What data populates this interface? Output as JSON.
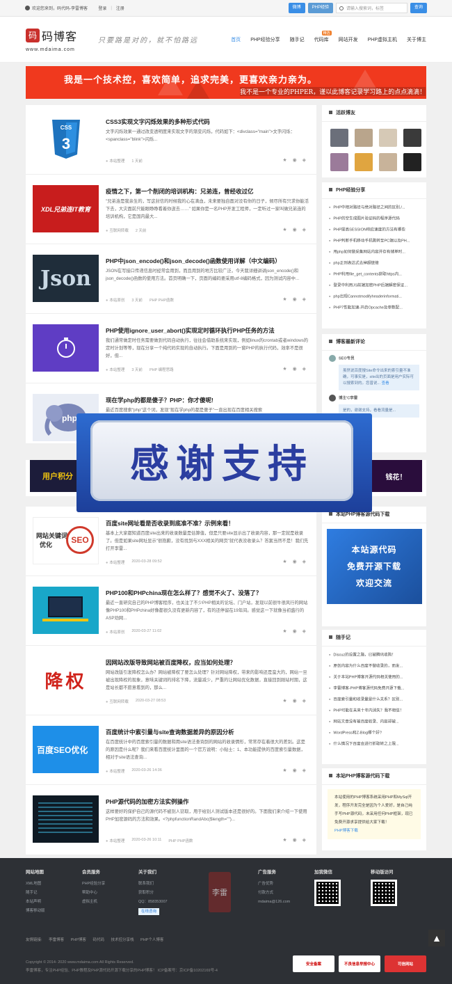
{
  "topbar": {
    "welcome": "欢迎您来到，码代码-李雷博客",
    "login": "登录",
    "register": "注册",
    "btn_sina": "微博",
    "btn_php": "PHP经验",
    "search_placeholder": "请输入搜索词，标签",
    "search_btn": "查询"
  },
  "header": {
    "logo_seal": "码",
    "logo_name": "码博客",
    "logo_url": "www.mdaima.com",
    "slogan": "只要路是对的，就不怕路远",
    "nav": [
      "首页",
      "PHP经验分享",
      "随手记",
      "代码库",
      "网站开发",
      "PHP虚拟主机",
      "关于博主"
    ],
    "nav_hot_badge": "精选"
  },
  "banner": {
    "line1": "我是一个技术控，喜欢简单，追求完美，更喜欢亲力亲为。",
    "line2": "我不是一个专业的PHPER，谨以此博客记录学习路上的点点滴滴！"
  },
  "posts": [
    {
      "title": "CSS3实现文字闪烁效果的多种形式代码",
      "desc": "文字闪烁效果一通过改变透明度来实现文字的渐变闪烁，代码如下：<divclass=\"main\">文字闪烁：<spanclass=\"blink\">闪烁...",
      "author": "本站整理",
      "date": "1 天前",
      "tags": "",
      "thumb": "css3"
    },
    {
      "title": "疫情之下，第一个削闭的培训机构：兄弟连，曾经收过亿",
      "desc": "\"兄弟连是我亲生的，写这封信的时候我的心在滴血，未来要独自面对没有你的日子，倾尽所有只求你能活下去，大灾面前只能眼睁睁看着你逝去……\" 如果你是一名PHP开发工程师，一定听过一家叫做兄弟连的培训机构，它是国内最大...",
      "author": "互联网转载",
      "date": "2 天前",
      "tags": "",
      "thumb": "xdl"
    },
    {
      "title": "PHP中json_encode()和json_decode()函数使用详解（中文编码）",
      "desc": "JSON在写接口传递信息时经常会用到，而且用到的地方比较广泛，今天我详细讲讲json_encode()和json_decode()函数的使用方法。首页明确一下，页面的编码要采用utf-8编码格式，因为测试内容中...",
      "author": "本站原创",
      "date": "3 天前",
      "tags": "PHP  PHP函数",
      "thumb": "json"
    },
    {
      "title": "PHP使用ignore_user_abort()实现定时循环执行PHP任务的方法",
      "desc": "我们通常做定时任务需要做到代码自动执行，往往会借助系统来实现，例如linux的crontab或者windows的定时计划等等，现在分享一个纯代码实现的自动执行。下面是用到的一窗PHP的执行代码，效率不是很好，但...",
      "author": "本站整理",
      "date": "3 天前",
      "tags": "PHP  编程思路",
      "thumb": "timer"
    },
    {
      "title": "现在学php的都是傻子？PHP：你才傻呢!",
      "desc": "最近百度搜索\"php\"这个词，发现\"现在学php的都是傻子\"一直出现在百度相关搜索",
      "author": "",
      "date": "",
      "tags": "",
      "thumb": "elephant"
    }
  ],
  "ad_strip": {
    "left": "用户积分",
    "right": "钱花！"
  },
  "overlay_text": "感谢支持",
  "posts2": [
    {
      "title": "百度site网址看是否收录到底准不准？示例来看！",
      "desc": "基本上大家都知道百度site出来的收录数量是估算值，但是只要site显示出了收录内容，那一定就是收录了。但是如果site网址显示\"很抱歉，没有找到与XXX相关的网页\"就代表没收录么？答案当然不是！我们先打开李雷...",
      "author": "本站整理",
      "date": "2020-03-28 09:52",
      "tags": "",
      "thumb": "seo"
    },
    {
      "title": "PHP100和PHPchina现在怎么样了？感觉不火了、没落了？",
      "desc": "最近一直研究自己的PHP博客程序，也关注了不少PHP相关的论坛、门户站，发现以前很牛很风行的网站像PHP100和PHPchina好像都很久没有更新内容了，有的还停留在19年间。感觉这一下就像当初盛行的ASP劝网...",
      "author": "本站原创",
      "date": "2020-03-27 11:02",
      "tags": "",
      "thumb": "desk"
    },
    {
      "title": "因网站改版导致网站被百度降权，应当如何处理？",
      "desc": "网站改版引发降权怎么办？网站被降权了要怎么处理？针对网站降权，带来的影响还是蛮大的，网站一旦被出现降权的现象，意味关键词的排名下降，流量减少，严重的让网站优化数据，直接回到刚站时期，这是站长都不愿意看到的，那么...",
      "author": "互联网转载",
      "date": "2020-03-27 08:53",
      "tags": "",
      "thumb": "jiangquan"
    },
    {
      "title": "百度统计中索引量与site查询数据差异的原因分析",
      "desc": "在百度统计中的百度索引量的数据和用site语法查询到的网站的收录情形，常常存在着很大的差别。这是的原因是什么呢？我们来看百度统计里面的一个官方说明：小贴士：1、本功能提供的百度索引量数据，相对于site语法查询...",
      "author": "本站整理",
      "date": "2020-03-26 14:36",
      "tags": "",
      "thumb": "baiduseo"
    },
    {
      "title": "PHP源代码的加密方法实例操作",
      "desc": "这样要好的保护自己的源代码不被别人窃取，用于给别人测试版本还是很好的。下面我们来介绍一下使用PHP加密源码的方法和效果。<?phpfunctionRandAbc($length=\"\")...",
      "author": "本站整理",
      "date": "2020-03-26 10:11",
      "tags": "PHP  PHP函数",
      "thumb": "code"
    }
  ],
  "sidebar": {
    "friends_title": "活跃博友",
    "exp_title": "PHP经验分享",
    "exp_items": [
      "PHP中相对路径与绝对路径之间的区别./...",
      "PHP的空生成图片验证码的程序源代码",
      "PHP提高SESSION响应速度的方法有哪些",
      "PHP判断手机移动手机跳转至PC端以及PH...",
      "用php如何做采集网站内容并存有储单时...",
      "php正则表达式去掉超链接",
      "PHP利用file_get_contents获取https内...",
      "登录中利用JS前端加密PHP后端解密保证...",
      "php出现Cannotmodifyheaderinformati...",
      "PHP7性能加速-开启Opcache及参数配..."
    ],
    "comments_title": "博客最新评论",
    "comment1_user": "SEO专员",
    "comment1_text": "虽然说百度搜Site命令出来的索引量不准确，可事实是，site出的页面是用户实际可以搜索到的。您曾说...",
    "comment1_link": "查看",
    "comment2_user": "博主'C李雷",
    "comment2_text": "是的，谢谢支持，看看流量是...",
    "source_title": "本站PHP博客源代码下载",
    "source_img_lines": [
      "本站源代码",
      "免费开源下载",
      "欢迎交流"
    ],
    "notes_title": "随手记",
    "notes_items": [
      "Discuz的设置之路，已被腾讯收购！",
      "原创内容为什么百度不做收录的，而发...",
      "关于本站PHP博客开源代码相关使用的...",
      "李雷博客-PHP博客源代码免费开源下载...",
      "百度索引量和收录量是什么关系？区别...",
      "PHP可能在未来十年内消失？我不相信！",
      "网站文章没有被百度收录、内容却被...",
      "WordPress和Z-Blog哪个好?",
      "什么情况下百度会进行抓取转之上限..."
    ],
    "download_title": "本站PHP博客源代码下载",
    "download_text": "本站使用的PHP博客系统采用PHP和MySql开发，程序开发完全是因为个人爱好，是自己纯手写PHP源代码，未采用任何PHP框架，现已免费开源求享提供给大家下载！",
    "download_link": "PHP博客下载"
  },
  "footer": {
    "col1_title": "网站地图",
    "col1": [
      "XML地图",
      "随手记",
      "本站声明",
      "博客移动版"
    ],
    "col2_title": "会员服务",
    "col2": [
      "PHP经验分享",
      "帮助中心",
      "虚拟主机"
    ],
    "col3_title": "关于我们",
    "col3": [
      "联系我们",
      "获取积分",
      "QQ：858353007"
    ],
    "col3_btn": "在线咨询",
    "col4_title": "广告服务",
    "col4": [
      "广告优势",
      "付款方式",
      "mdaima@126.com"
    ],
    "col5_title": "加我微信",
    "col6_title": "移动版访问",
    "stamp": "李雷",
    "links_label": "友情链接:",
    "links": [
      "李雷博客",
      "PHP博客",
      "码代码",
      "技术控分享栈",
      "PHP个人博客"
    ],
    "copy1": "Copyright © 2014- 2020 www.mdaima.com All Rights Reserved.",
    "copy2": "李雷博客，专注PHP经验、PHP教程及PHP源代码开源下载分享的PHP博客！  ICP备案号：京ICP备10202169号-4",
    "badges": [
      "安全备案",
      "不良信息举报中心",
      "可信网站"
    ]
  }
}
